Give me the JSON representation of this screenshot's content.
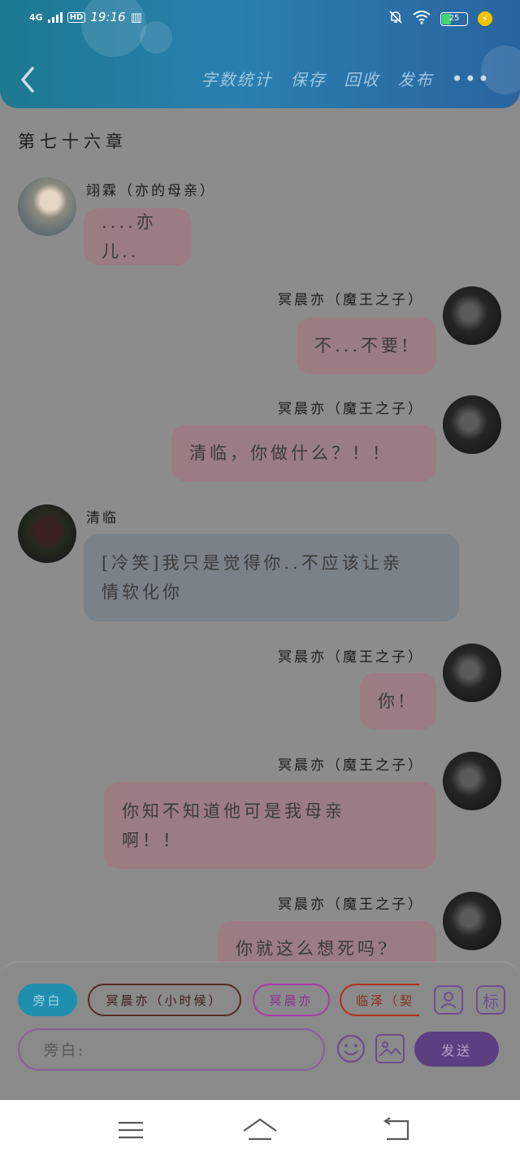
{
  "status": {
    "network": "4G",
    "time": "19:16",
    "hd": "HD",
    "battery": "25"
  },
  "header": {
    "menu": [
      "字数统计",
      "保存",
      "回收",
      "发布"
    ],
    "more": "•••"
  },
  "chapter_title": "第七十六章",
  "messages": [
    {
      "speaker": "翊霖（亦的母亲）",
      "text": "....亦儿..",
      "side": "left"
    },
    {
      "speaker": "冥晨亦（魔王之子）",
      "text": "不...不要!",
      "side": "right"
    },
    {
      "speaker": "冥晨亦（魔王之子）",
      "text": "清临，你做什么？！！",
      "side": "right"
    },
    {
      "speaker": "清临",
      "text_line1": "[冷笑]我只是觉得你..不应该让亲",
      "text_line2": "情软化你",
      "side": "left"
    },
    {
      "speaker": "冥晨亦（魔王之子）",
      "text": "你!",
      "side": "right"
    },
    {
      "speaker": "冥晨亦（魔王之子）",
      "text_line1": "你知不知道他可是我母亲",
      "text_line2": "啊！！",
      "side": "right"
    },
    {
      "speaker": "冥晨亦（魔王之子）",
      "text": "你就这么想死吗?",
      "side": "right"
    }
  ],
  "composer": {
    "chips": [
      "旁白",
      "冥晨亦（小时候）",
      "冥晨亦",
      "临泽（契"
    ],
    "chip_colors": [
      "#1f8fb0",
      "#5a2a22",
      "#a83aa6",
      "#b0301f"
    ],
    "tag_button": "标",
    "input_placeholder": "旁白:",
    "send_label": "发送"
  }
}
